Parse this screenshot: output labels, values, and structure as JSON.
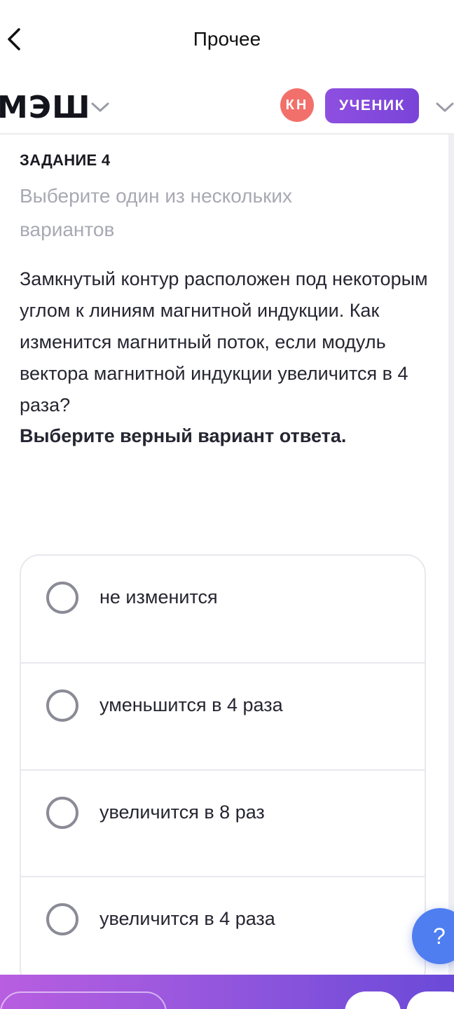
{
  "nav": {
    "title": "Прочее",
    "back_icon": "chevron-left-icon"
  },
  "header": {
    "logo": "МЭШ",
    "logo_menu_icon": "chevron-down-icon",
    "avatar_initials": "КН",
    "avatar_color": "#f2706b",
    "role": "УЧЕНИК",
    "role_color": "#8e4fe0",
    "role_menu_icon": "chevron-down-icon"
  },
  "task": {
    "label": "ЗАДАНИЕ 4",
    "instruction": "Выберите один из нескольких вариантов",
    "question": "Замкнутый контур расположен под некоторым углом к линиям магнитной индукции. Как изменится магнитный поток, если модуль вектора магнитной индукции увеличится в 4 раза?",
    "emphasis": "Выберите верный вариант ответа."
  },
  "options": [
    {
      "label": "не изменится",
      "selected": false
    },
    {
      "label": "уменьшится в 4 раза",
      "selected": false
    },
    {
      "label": "увеличится в 8 раз",
      "selected": false
    },
    {
      "label": "увеличится в 4 раза",
      "selected": false
    }
  ],
  "help": {
    "label": "?",
    "color": "#4f7ef0"
  }
}
